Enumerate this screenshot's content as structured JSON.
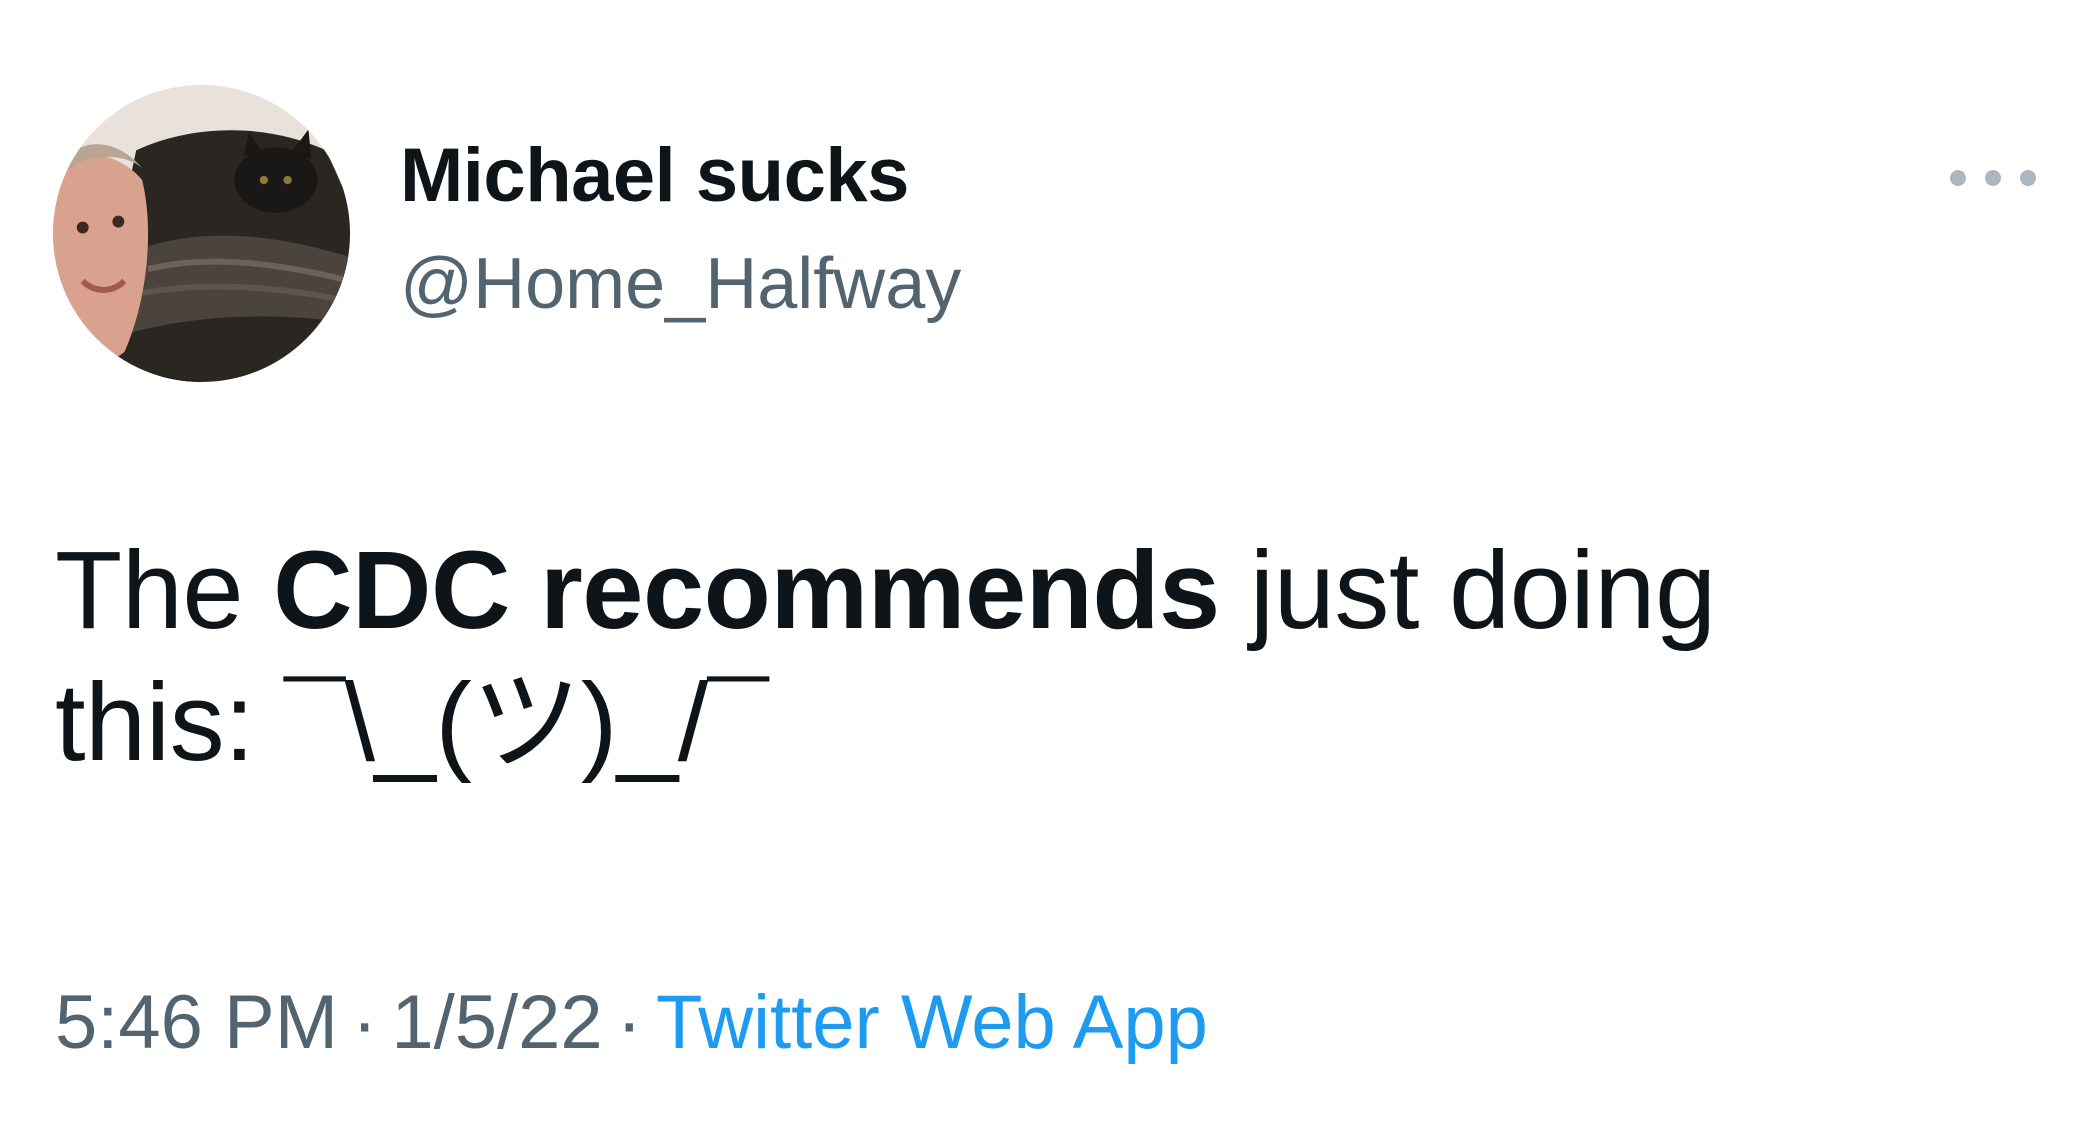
{
  "author": {
    "display_name": "Michael sucks",
    "handle": "@Home_Halfway"
  },
  "tweet": {
    "text_before": "The ",
    "text_bold": "CDC recommends",
    "text_after": " just doing",
    "text_line2": "this: ¯\\_(ツ)_/¯"
  },
  "meta": {
    "time": "5:46 PM",
    "separator": "·",
    "date": "1/5/22",
    "app": "Twitter Web App"
  },
  "icons": {
    "more": "more-horizontal-icon",
    "avatar": "profile-photo"
  },
  "colors": {
    "text_primary": "#0f1419",
    "text_secondary": "#536471",
    "link": "#1d9bf0",
    "more_dots": "#aeb6bd"
  }
}
